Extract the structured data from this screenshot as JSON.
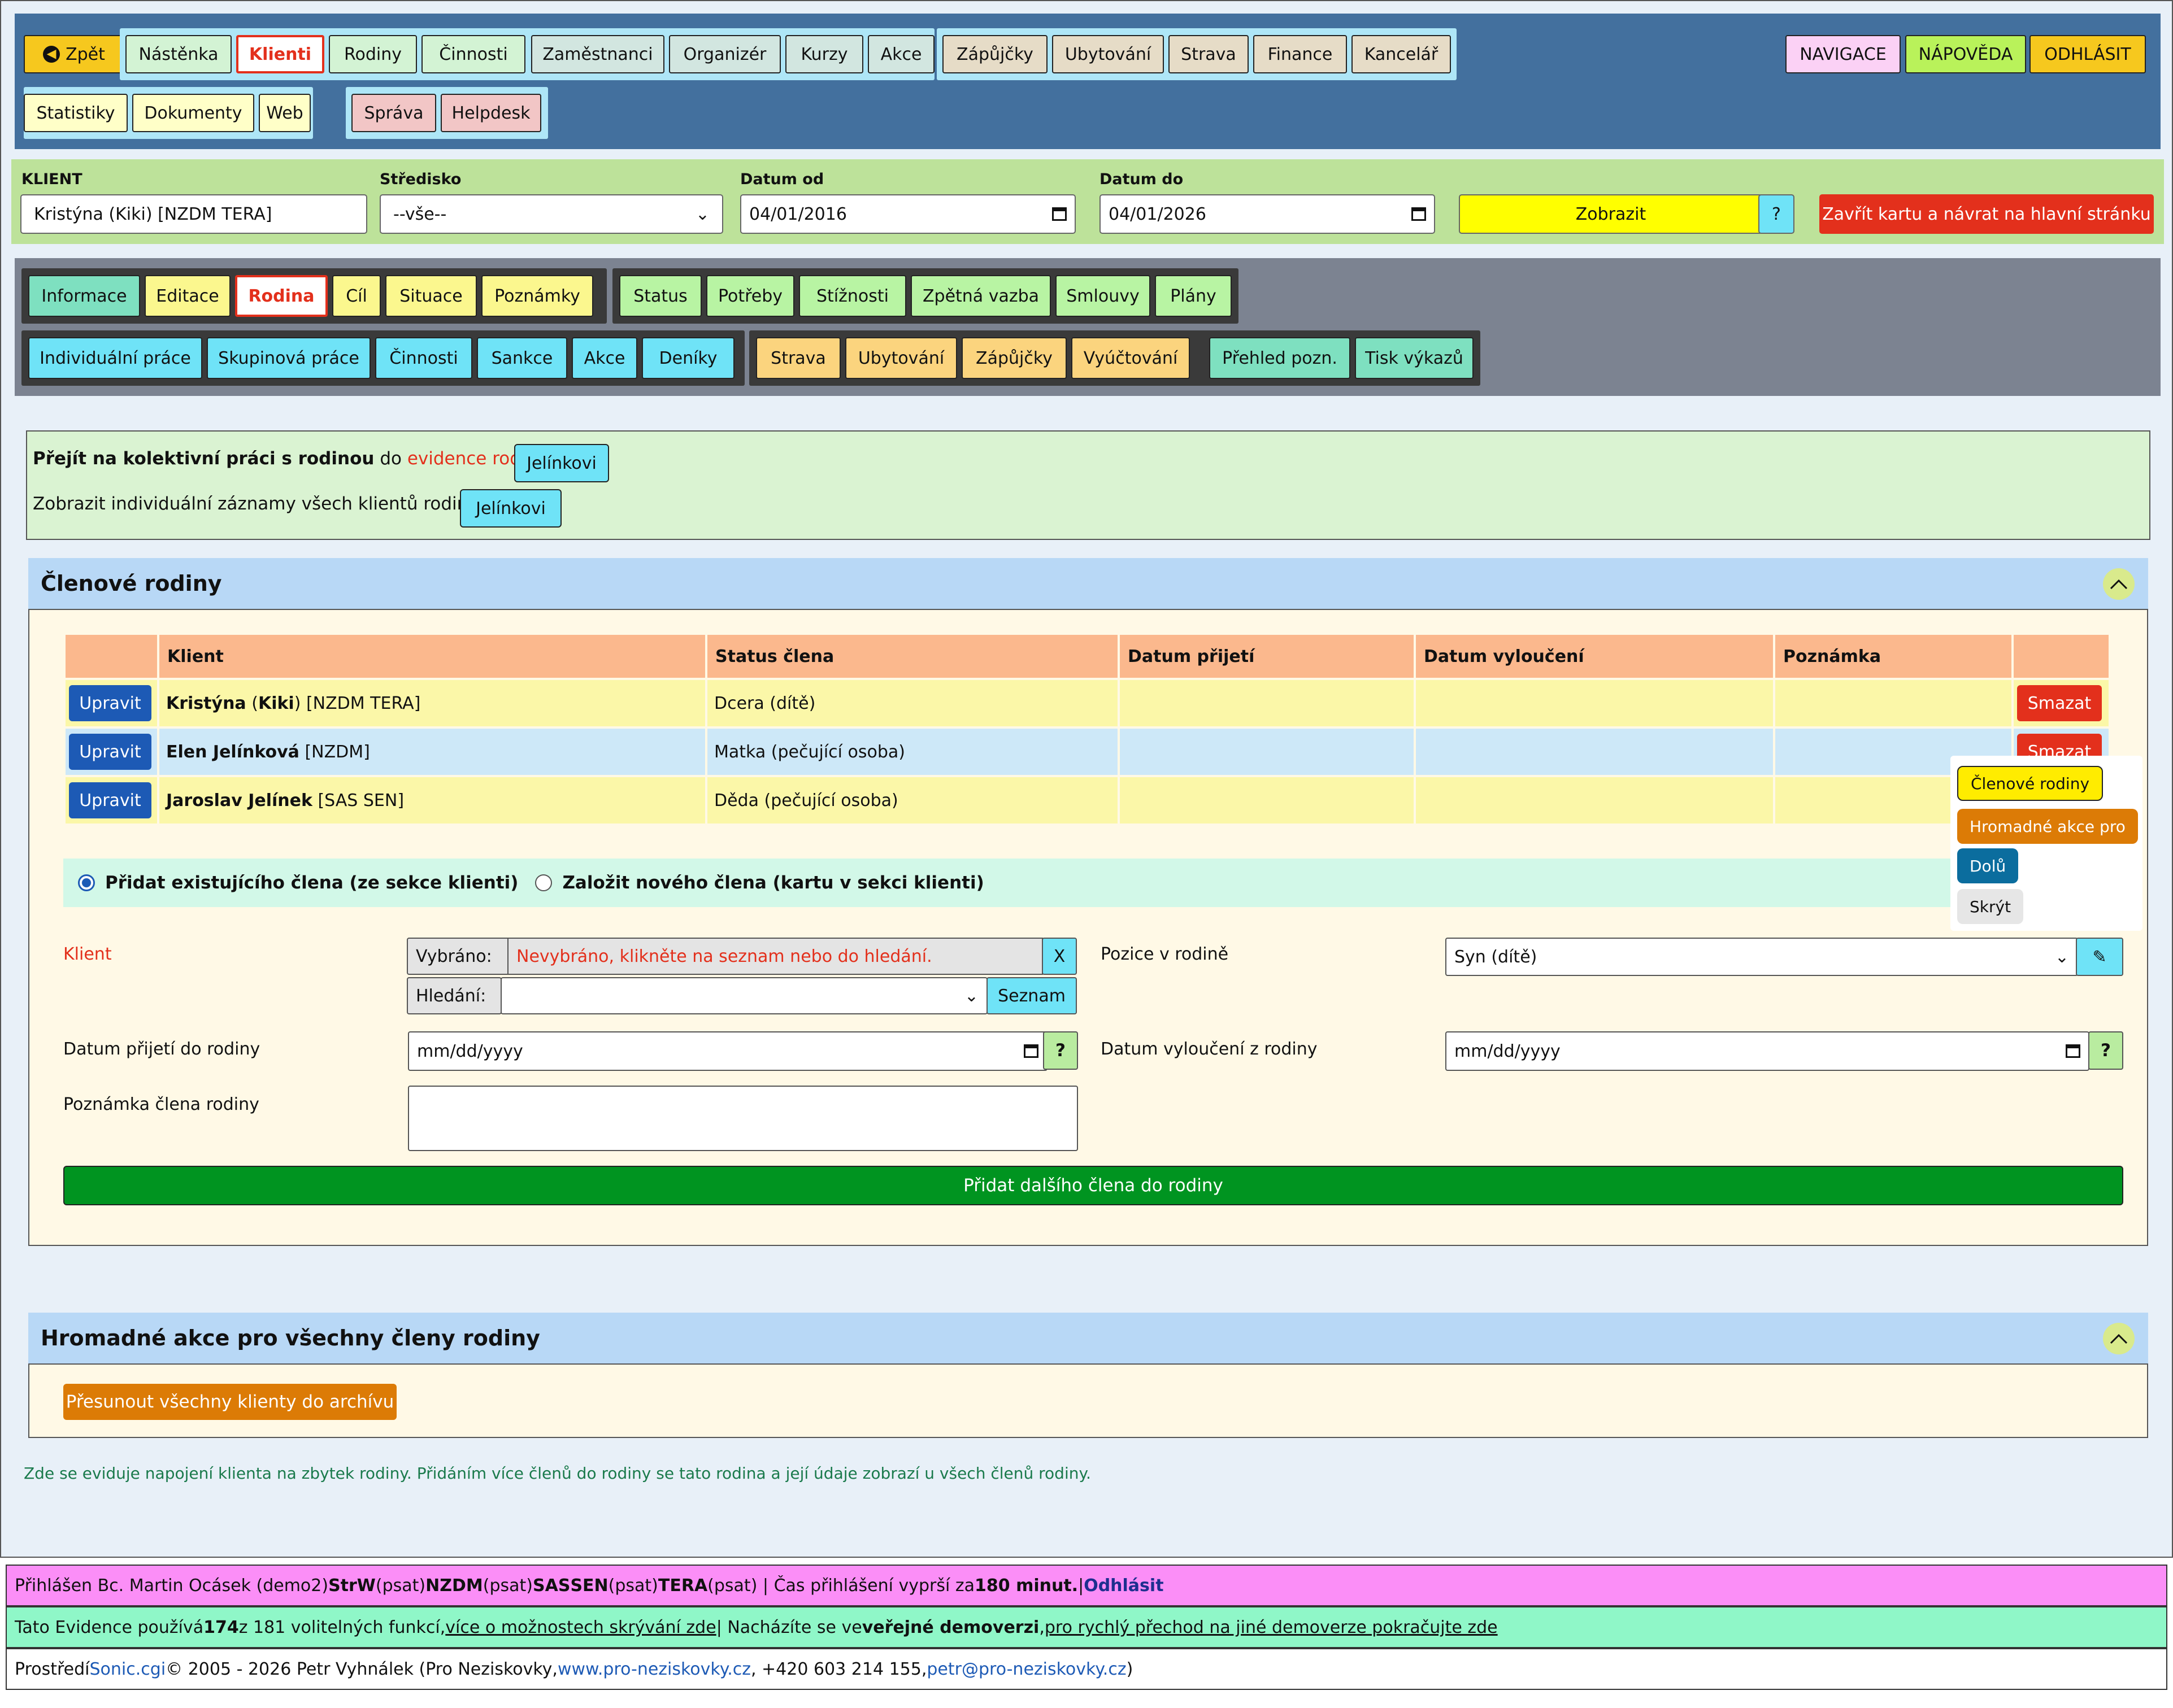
{
  "nav": {
    "back": "Zpět",
    "row1_g1": [
      "Nástěnka",
      "Klienti",
      "Rodiny",
      "Činnosti"
    ],
    "row1_g2": [
      "Zaměstnanci",
      "Organizér",
      "Kurzy",
      "Akce"
    ],
    "row1_g3": [
      "Zápůjčky",
      "Ubytování",
      "Strava",
      "Finance",
      "Kancelář"
    ],
    "row2_g1": [
      "Statistiky",
      "Dokumenty",
      "Web"
    ],
    "row2_g2": [
      "Správa",
      "Helpdesk"
    ],
    "right": [
      "NAVIGACE",
      "NÁPOVĚDA",
      "ODHLÁSIT"
    ]
  },
  "filter": {
    "client_label": "KLIENT",
    "client_value": "Kristýna (Kiki) [NZDM TERA]",
    "center_label": "Středisko",
    "center_value": "--vše--",
    "from_label": "Datum od",
    "from_value": "04/01/2016",
    "to_label": "Datum do",
    "to_value": "04/01/2026",
    "show_btn": "Zobrazit",
    "help_btn": "?",
    "close_btn": "Zavřít kartu a návrat na hlavní stránku"
  },
  "subnav": {
    "row1_g1": [
      "Informace",
      "Editace",
      "Rodina",
      "Cíl",
      "Situace",
      "Poznámky"
    ],
    "row1_g2": [
      "Status",
      "Potřeby",
      "Stížnosti",
      "Zpětná vazba",
      "Smlouvy",
      "Plány"
    ],
    "row2_g1": [
      "Individuální práce",
      "Skupinová práce",
      "Činnosti",
      "Sankce",
      "Akce",
      "Deníky"
    ],
    "row2_g2": [
      "Strava",
      "Ubytování",
      "Zápůjčky",
      "Vyúčtování"
    ],
    "row2_g3": [
      "Přehled pozn.",
      "Tisk výkazů"
    ]
  },
  "info": {
    "line1_bold": "Přejít na kolektivní práci s rodinou",
    "line1_mid": "do",
    "line1_link": "evidence rodin",
    "line1_colon": ":",
    "line1_btn": "Jelínkovi",
    "line2": "Zobrazit individuální záznamy všech klientů rodiny:",
    "line2_btn": "Jelínkovi"
  },
  "members": {
    "title": "Členové rodiny",
    "headers": [
      "",
      "Klient",
      "Status člena",
      "Datum přijetí",
      "Datum vyloučení",
      "Poznámka",
      ""
    ],
    "edit_label": "Upravit",
    "delete_label": "Smazat",
    "rows": [
      {
        "name_b1": "Kristýna",
        "name_m": "(",
        "name_b2": "Kiki",
        "name_rest": ") [NZDM TERA]",
        "status": "Dcera (dítě)"
      },
      {
        "name_b1": "Elen Jelínková",
        "name_m": "",
        "name_b2": "",
        "name_rest": " [NZDM]",
        "status": "Matka (pečující osoba)"
      },
      {
        "name_b1": "Jaroslav Jelínek",
        "name_m": "",
        "name_b2": "",
        "name_rest": " [SAS SEN]",
        "status": "Děda (pečující osoba)"
      }
    ],
    "radio1": "Přidat existujícího člena (ze sekce klienti)",
    "radio2": "Založit nového člena (kartu v sekci klienti)",
    "client_label": "Klient",
    "selected_label": "Vybráno:",
    "selected_value": "Nevybráno, klikněte na seznam nebo do hledání.",
    "clear_btn": "X",
    "search_label": "Hledání:",
    "list_btn": "Seznam",
    "position_label": "Pozice v rodině",
    "position_value": "Syn (dítě)",
    "join_label": "Datum přijetí do rodiny",
    "join_placeholder": "mm/dd/yyyy",
    "leave_label": "Datum vyloučení z rodiny",
    "leave_placeholder": "mm/dd/yyyy",
    "q": "?",
    "note_label": "Poznámka člena rodiny",
    "add_btn": "Přidat dalšího člena do rodiny"
  },
  "bulk": {
    "title": "Hromadné akce pro všechny členy rodiny",
    "archive_btn": "Přesunout všechny klienty do archívu"
  },
  "hint": "Zde se eviduje napojení klienta na zbytek rodiny. Přidáním více členů do rodiny se tato rodina a její údaje zobrazí u všech členů rodiny.",
  "popup": [
    "Členové rodiny",
    "Hromadné akce pro",
    "Dolů",
    "Skrýt"
  ],
  "footer": {
    "l1_a": "Přihlášen Bc. Martin Ocásek (demo2) ",
    "l1_b1": "StrW",
    "l1_c1": " (psat) ",
    "l1_b2": "NZDM",
    "l1_c2": " (psat) ",
    "l1_b3": "SAS",
    "l1_c3": " ",
    "l1_b4": "SEN",
    "l1_c4": " (psat) ",
    "l1_b5": "TERA",
    "l1_c5": " (psat)  |  Čas přihlášení vyprší za ",
    "l1_b6": "180 minut.",
    "l1_c6": "  |  ",
    "l1_link": "Odhlásit",
    "l2_a": "Tato Evidence používá ",
    "l2_b": "174",
    "l2_c": " z 181 volitelných funkcí, ",
    "l2_link": "více o možnostech skrývání zde",
    "l2_d": "  |  Nacházíte se ve ",
    "l2_e": "veřejné demoverzi",
    "l2_f": ", ",
    "l2_link2": "pro rychlý přechod na jiné demoverze pokračujte zde",
    "l3_a": "Prostředí ",
    "l3_link1": "Sonic.cgi",
    "l3_b": " © 2005 - 2026 Petr Vyhnálek (Pro Neziskovky, ",
    "l3_link2": "www.pro-neziskovky.cz",
    "l3_c": ", +420 603 214 155, ",
    "l3_link3": "petr@pro-neziskovky.cz",
    "l3_d": ")"
  },
  "colors": {
    "nav_bg": "#43709e",
    "filter_bg": "#bde29a",
    "subnav_bg": "#7c8391",
    "accent_red": "#e3301c",
    "edit_blue": "#1d5ab5",
    "add_green": "#009420"
  }
}
